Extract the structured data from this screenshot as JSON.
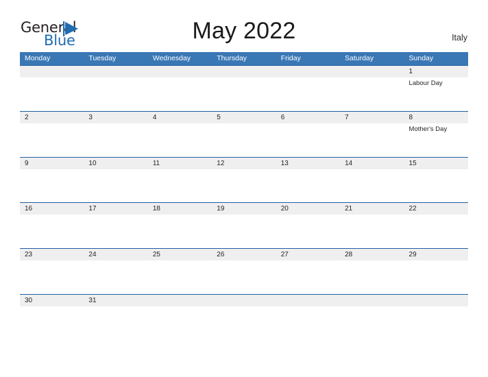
{
  "brand": {
    "name_part1": "General",
    "name_part2": "Blue",
    "flag_icon": "flag-triangle-icon",
    "accent_color": "#1f6cb0"
  },
  "header": {
    "title": "May 2022",
    "country": "Italy"
  },
  "colors": {
    "weekday_header_bg": "#3a77b5",
    "weekday_header_text": "#ffffff",
    "row_divider": "#1f5fa0",
    "date_band_bg": "#efefef",
    "text": "#231f20"
  },
  "calendar": {
    "weekdays": [
      "Monday",
      "Tuesday",
      "Wednesday",
      "Thursday",
      "Friday",
      "Saturday",
      "Sunday"
    ],
    "weeks": [
      [
        {
          "day": "",
          "event": ""
        },
        {
          "day": "",
          "event": ""
        },
        {
          "day": "",
          "event": ""
        },
        {
          "day": "",
          "event": ""
        },
        {
          "day": "",
          "event": ""
        },
        {
          "day": "",
          "event": ""
        },
        {
          "day": "1",
          "event": "Labour Day"
        }
      ],
      [
        {
          "day": "2",
          "event": ""
        },
        {
          "day": "3",
          "event": ""
        },
        {
          "day": "4",
          "event": ""
        },
        {
          "day": "5",
          "event": ""
        },
        {
          "day": "6",
          "event": ""
        },
        {
          "day": "7",
          "event": ""
        },
        {
          "day": "8",
          "event": "Mother's Day"
        }
      ],
      [
        {
          "day": "9",
          "event": ""
        },
        {
          "day": "10",
          "event": ""
        },
        {
          "day": "11",
          "event": ""
        },
        {
          "day": "12",
          "event": ""
        },
        {
          "day": "13",
          "event": ""
        },
        {
          "day": "14",
          "event": ""
        },
        {
          "day": "15",
          "event": ""
        }
      ],
      [
        {
          "day": "16",
          "event": ""
        },
        {
          "day": "17",
          "event": ""
        },
        {
          "day": "18",
          "event": ""
        },
        {
          "day": "19",
          "event": ""
        },
        {
          "day": "20",
          "event": ""
        },
        {
          "day": "21",
          "event": ""
        },
        {
          "day": "22",
          "event": ""
        }
      ],
      [
        {
          "day": "23",
          "event": ""
        },
        {
          "day": "24",
          "event": ""
        },
        {
          "day": "25",
          "event": ""
        },
        {
          "day": "26",
          "event": ""
        },
        {
          "day": "27",
          "event": ""
        },
        {
          "day": "28",
          "event": ""
        },
        {
          "day": "29",
          "event": ""
        }
      ],
      [
        {
          "day": "30",
          "event": ""
        },
        {
          "day": "31",
          "event": ""
        },
        {
          "day": "",
          "event": ""
        },
        {
          "day": "",
          "event": ""
        },
        {
          "day": "",
          "event": ""
        },
        {
          "day": "",
          "event": ""
        },
        {
          "day": "",
          "event": ""
        }
      ]
    ]
  }
}
